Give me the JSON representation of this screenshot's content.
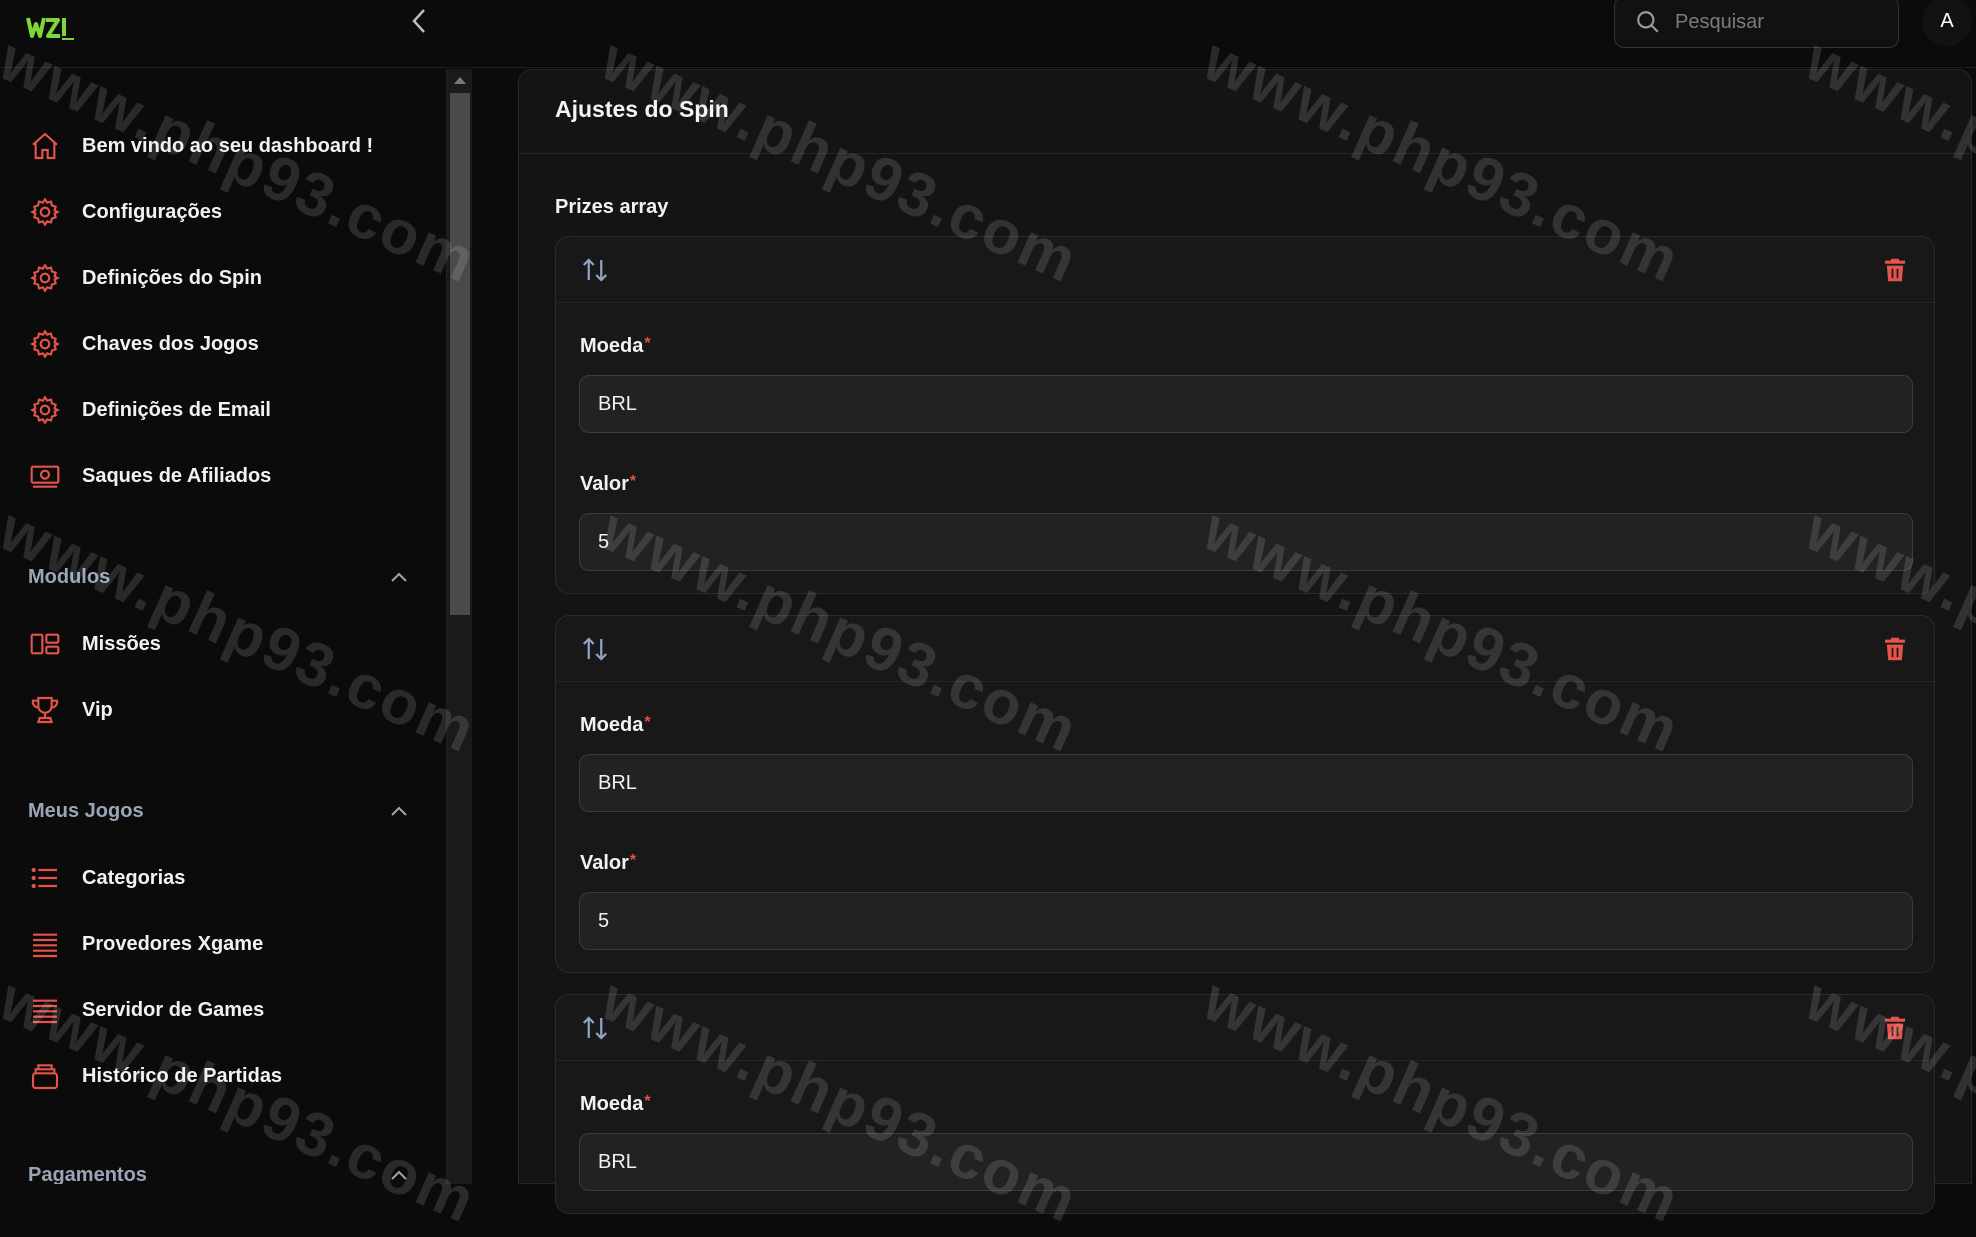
{
  "app": {
    "logo_text": "WZI"
  },
  "header": {
    "search_placeholder": "Pesquisar",
    "avatar_initial": "A"
  },
  "sidebar": {
    "items": [
      {
        "label": "Bem vindo ao seu dashboard !",
        "icon": "home-icon"
      },
      {
        "label": "Configurações",
        "icon": "gear-icon"
      },
      {
        "label": "Definições do Spin",
        "icon": "gear-icon"
      },
      {
        "label": "Chaves dos Jogos",
        "icon": "gear-icon"
      },
      {
        "label": "Definições de Email",
        "icon": "gear-icon"
      },
      {
        "label": "Saques de Afiliados",
        "icon": "cash-icon"
      }
    ],
    "groups": [
      {
        "label": "Modulos",
        "items": [
          {
            "label": "Missões",
            "icon": "layout-icon"
          },
          {
            "label": "Vip",
            "icon": "trophy-icon"
          }
        ]
      },
      {
        "label": "Meus Jogos",
        "items": [
          {
            "label": "Categorias",
            "icon": "list-icon"
          },
          {
            "label": "Provedores Xgame",
            "icon": "queue-list-icon"
          },
          {
            "label": "Servidor de Games",
            "icon": "queue-list-icon"
          },
          {
            "label": "Histórico de Partidas",
            "icon": "stack-icon"
          }
        ]
      },
      {
        "label": "Pagamentos",
        "items": []
      }
    ]
  },
  "main": {
    "title": "Ajustes do Spin",
    "section_label": "Prizes array",
    "prizes": [
      {
        "moeda_label": "Moeda",
        "moeda_value": "BRL",
        "valor_label": "Valor",
        "valor_value": "5"
      },
      {
        "moeda_label": "Moeda",
        "moeda_value": "BRL",
        "valor_label": "Valor",
        "valor_value": "5"
      },
      {
        "moeda_label": "Moeda",
        "moeda_value": "BRL"
      }
    ]
  },
  "watermark": "www.php93.com",
  "colors": {
    "accent": "#e5534b",
    "background": "#0b0b0b",
    "panel": "#141414"
  }
}
